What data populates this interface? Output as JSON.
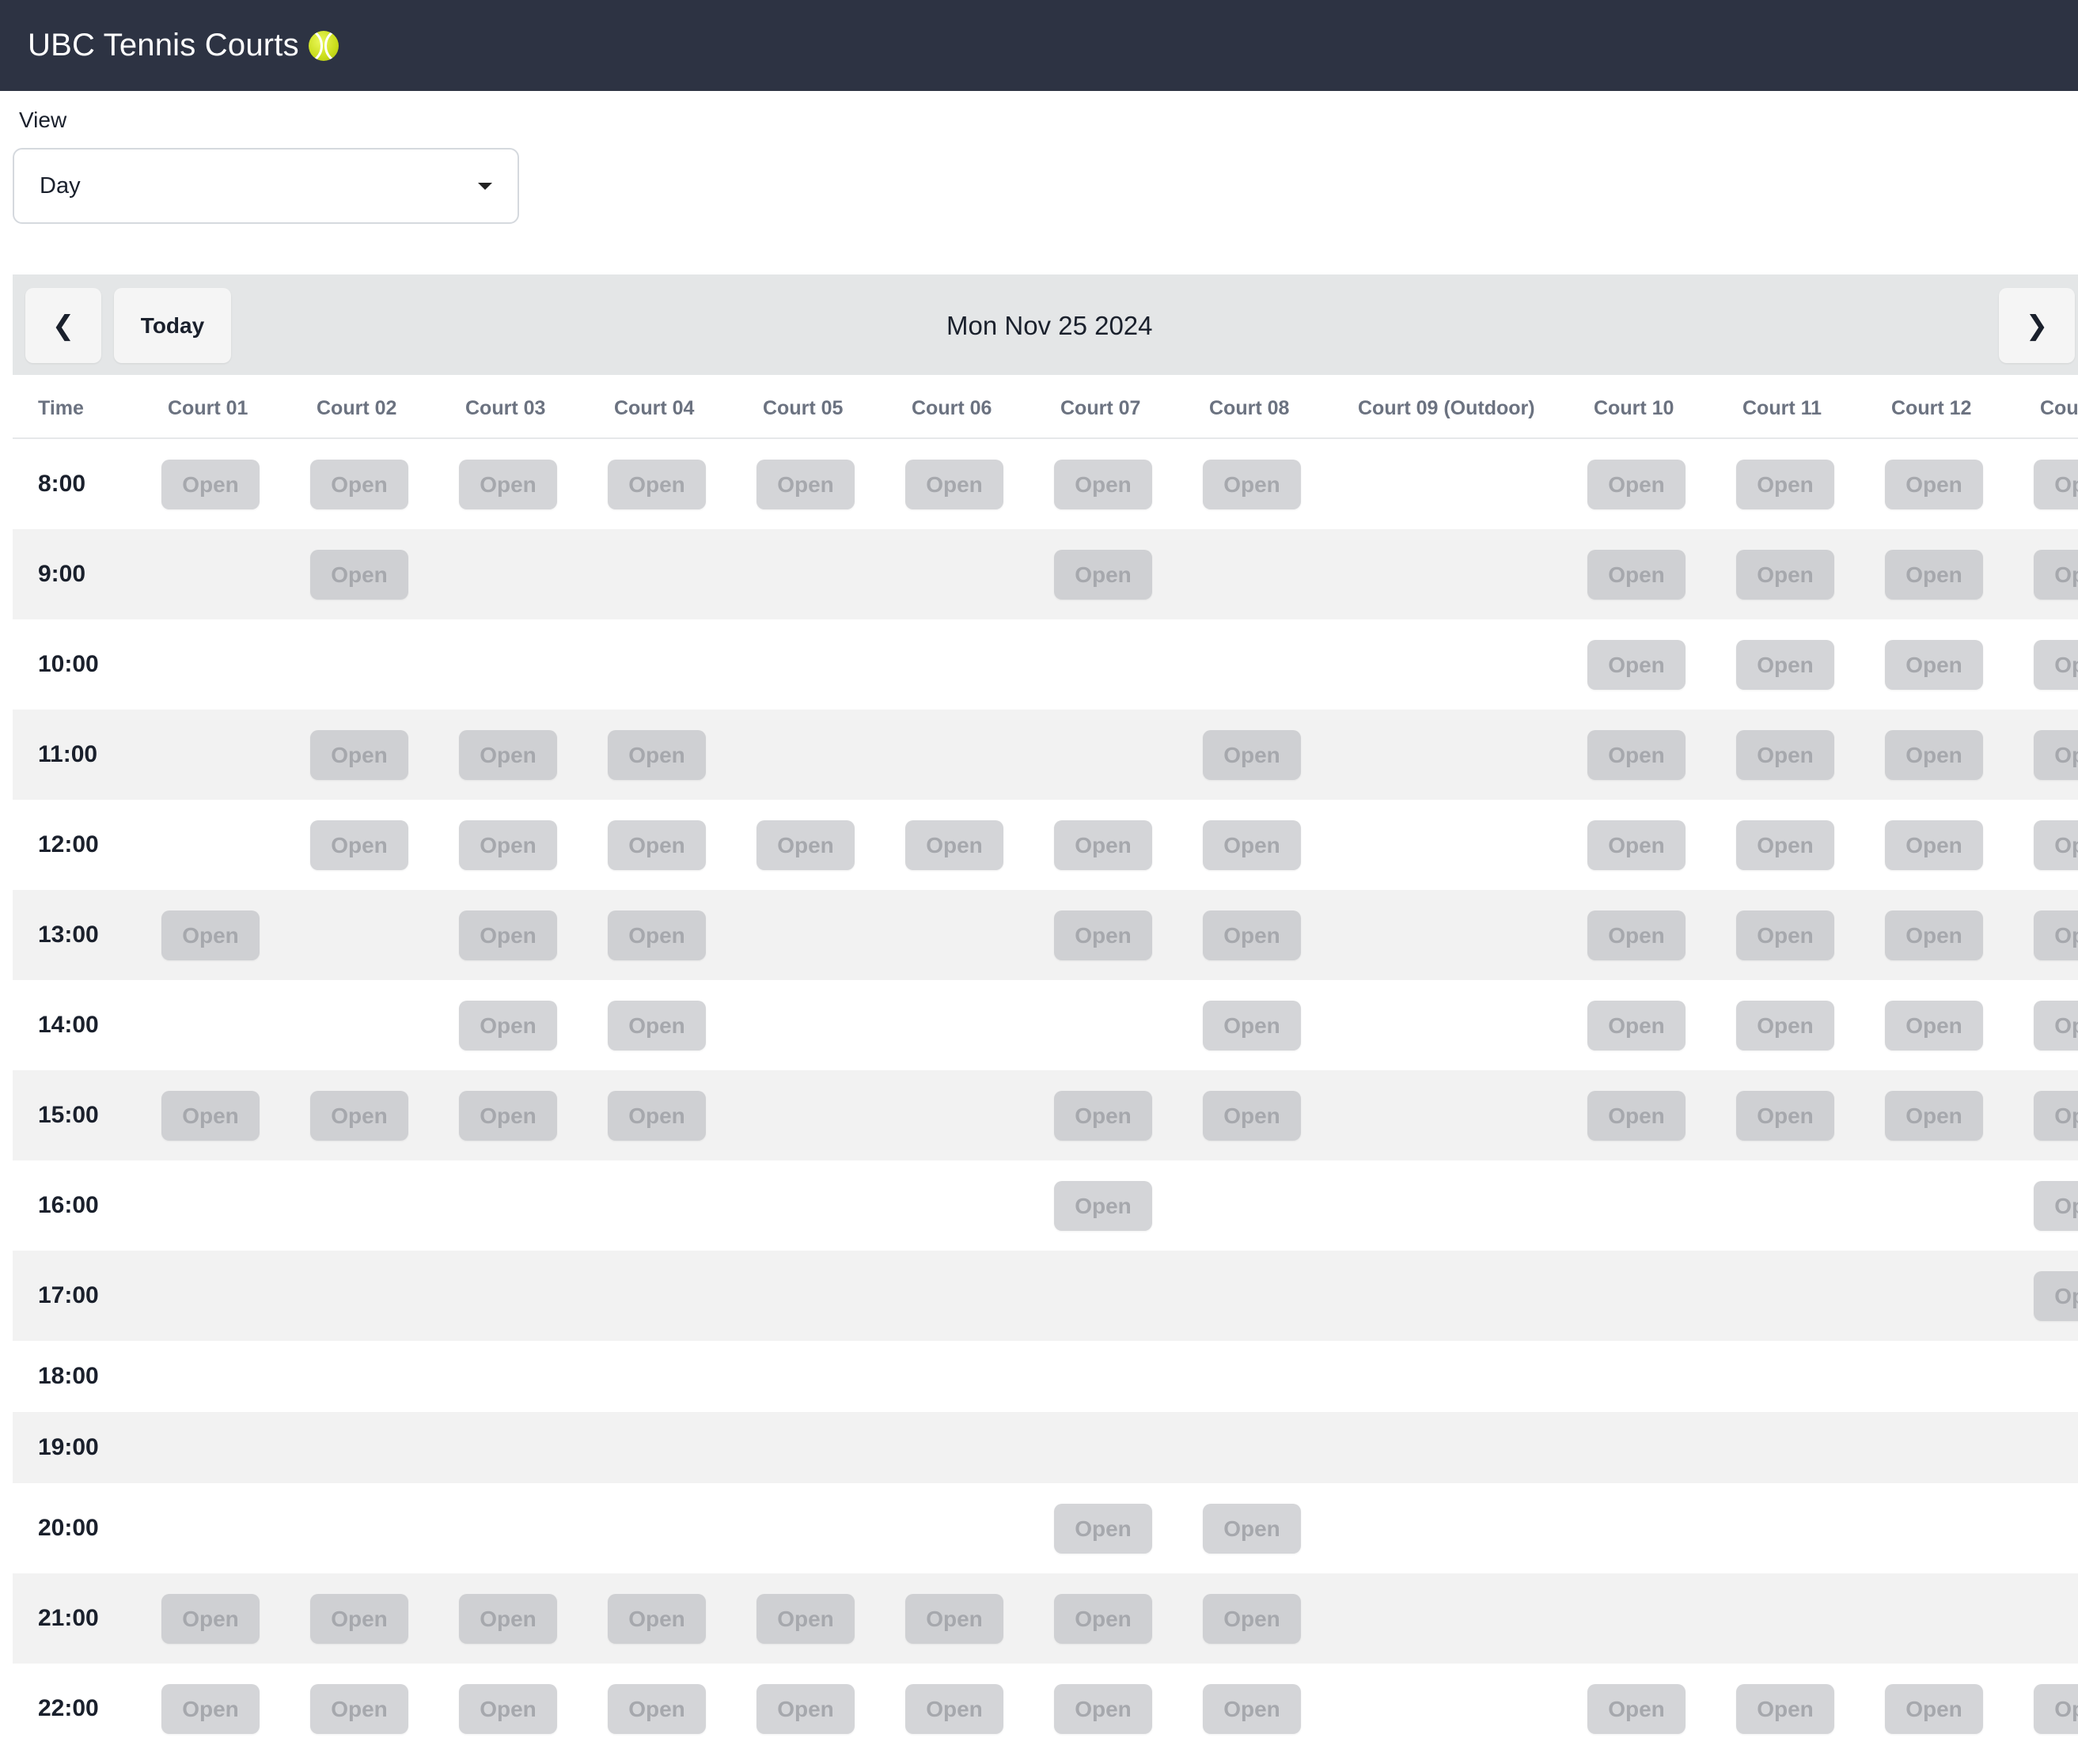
{
  "app": {
    "title": "UBC Tennis Courts",
    "brand_icon": "tennis-ball-icon",
    "colors": {
      "navbar": "#2d3343",
      "slot_bg": "#d4d5d8",
      "slot_text": "#a6a8ad",
      "toolbar_bg": "#e4e6e7"
    }
  },
  "view_selector": {
    "label": "View",
    "selected": "Day"
  },
  "toolbar": {
    "prev_icon": "chevron-left-icon",
    "today_label": "Today",
    "date": "Mon Nov 25 2024",
    "next_icon": "chevron-right-icon"
  },
  "grid": {
    "time_header": "Time",
    "slot_label": "Open",
    "courts": [
      "Court 01",
      "Court 02",
      "Court 03",
      "Court 04",
      "Court 05",
      "Court 06",
      "Court 07",
      "Court 08",
      "Court 09 (Outdoor)",
      "Court 10",
      "Court 11",
      "Court 12",
      "Court"
    ],
    "rows": [
      {
        "time": "8:00",
        "open": [
          0,
          1,
          2,
          3,
          4,
          5,
          6,
          7,
          9,
          10,
          11,
          12
        ]
      },
      {
        "time": "9:00",
        "open": [
          1,
          6,
          9,
          10,
          11,
          12
        ]
      },
      {
        "time": "10:00",
        "open": [
          9,
          10,
          11,
          12
        ]
      },
      {
        "time": "11:00",
        "open": [
          1,
          2,
          3,
          7,
          9,
          10,
          11,
          12
        ]
      },
      {
        "time": "12:00",
        "open": [
          1,
          2,
          3,
          4,
          5,
          6,
          7,
          9,
          10,
          11,
          12
        ]
      },
      {
        "time": "13:00",
        "open": [
          0,
          2,
          3,
          6,
          7,
          9,
          10,
          11,
          12
        ]
      },
      {
        "time": "14:00",
        "open": [
          2,
          3,
          7,
          9,
          10,
          11,
          12
        ]
      },
      {
        "time": "15:00",
        "open": [
          0,
          1,
          2,
          3,
          6,
          7,
          9,
          10,
          11,
          12
        ]
      },
      {
        "time": "16:00",
        "open": [
          6,
          12
        ]
      },
      {
        "time": "17:00",
        "open": [
          12
        ]
      },
      {
        "time": "18:00",
        "open": []
      },
      {
        "time": "19:00",
        "open": []
      },
      {
        "time": "20:00",
        "open": [
          6,
          7
        ]
      },
      {
        "time": "21:00",
        "open": [
          0,
          1,
          2,
          3,
          4,
          5,
          6,
          7
        ]
      },
      {
        "time": "22:00",
        "open": [
          0,
          1,
          2,
          3,
          4,
          5,
          6,
          7,
          9,
          10,
          11,
          12
        ]
      }
    ]
  }
}
